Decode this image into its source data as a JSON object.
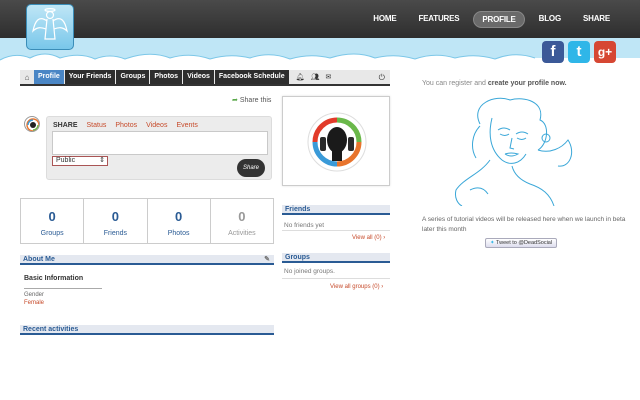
{
  "header": {
    "nav": [
      {
        "label": "HOME"
      },
      {
        "label": "FEATURES"
      },
      {
        "label": "PROFILE",
        "active": true
      },
      {
        "label": "BLOG"
      },
      {
        "label": "SHARE"
      }
    ],
    "social": {
      "facebook": "f",
      "twitter": "t",
      "googleplus": "g+"
    }
  },
  "tabs": [
    {
      "label": "Profile",
      "active": true
    },
    {
      "label": "Your Friends"
    },
    {
      "label": "Groups"
    },
    {
      "label": "Photos"
    },
    {
      "label": "Videos"
    },
    {
      "label": "Facebook Schedule"
    }
  ],
  "share": {
    "share_this": "Share this",
    "label": "SHARE",
    "tabs": [
      "Status",
      "Photos",
      "Videos",
      "Events"
    ],
    "privacy": "Public",
    "button": "Share"
  },
  "stats": [
    {
      "num": "0",
      "label": "Groups"
    },
    {
      "num": "0",
      "label": "Friends"
    },
    {
      "num": "0",
      "label": "Photos"
    },
    {
      "num": "0",
      "label": "Activities"
    }
  ],
  "about": {
    "title": "About Me",
    "basic": "Basic Information",
    "gender_label": "Gender",
    "gender_value": "Female"
  },
  "recent": {
    "title": "Recent activities"
  },
  "friends": {
    "title": "Friends",
    "empty": "No friends yet",
    "view_all": "View all (0) ›"
  },
  "groups": {
    "title": "Groups",
    "empty": "No joined groups.",
    "view_all": "View all groups (0) ›"
  },
  "right": {
    "register_prefix": "You can register and ",
    "register_bold": "create your profile now.",
    "tutorial": "A series of tutorial videos will be released here when we launch in beta later this month",
    "tweet": "Tweet to @DeadSocial"
  },
  "colors": {
    "accent": "#2a5b94",
    "link": "#c64a2a",
    "topbar": "#3a3a3a",
    "sky": "#bfe6f6"
  }
}
